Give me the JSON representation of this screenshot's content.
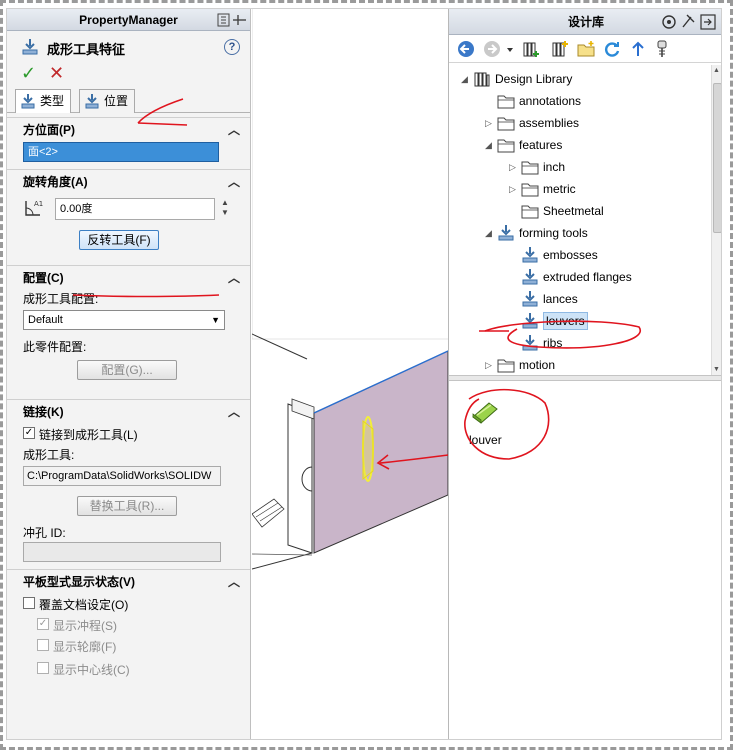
{
  "property_manager": {
    "title": "PropertyManager",
    "feature_name": "成形工具特征",
    "help": "?",
    "ok": "✓",
    "cancel": "✕",
    "tabs": [
      {
        "label": "类型",
        "active": true
      },
      {
        "label": "位置",
        "active": false
      }
    ],
    "orientation": {
      "header": "方位面(P)",
      "value": "面<2>"
    },
    "rotation": {
      "header": "旋转角度(A)",
      "value": "0.00度",
      "flip_button": "反转工具(F)"
    },
    "config": {
      "header": "配置(C)",
      "tool_config_label": "成形工具配置:",
      "tool_config_value": "Default",
      "part_config_label": "此零件配置:",
      "config_button": "配置(G)..."
    },
    "link": {
      "header": "链接(K)",
      "link_checkbox": "链接到成形工具(L)",
      "link_checked": true,
      "tool_label": "成形工具:",
      "tool_path": "C:\\ProgramData\\SolidWorks\\SOLIDW",
      "replace_button": "替换工具(R)...",
      "punch_id_label": "冲孔 ID:"
    },
    "flat": {
      "header": "平板型式显示状态(V)",
      "override": "覆盖文档设定(O)",
      "show_punch": "显示冲程(S)",
      "show_outline": "显示轮廓(F)",
      "show_centerline": "显示中心线(C)"
    }
  },
  "design_library": {
    "title": "设计库",
    "tree": [
      {
        "label": "Design Library",
        "level": 0,
        "expander": "expanded",
        "icon": "library-icon"
      },
      {
        "label": "annotations",
        "level": 1,
        "expander": "none",
        "icon": "folder-icon"
      },
      {
        "label": "assemblies",
        "level": 1,
        "expander": "collapsed",
        "icon": "folder-icon"
      },
      {
        "label": "features",
        "level": 1,
        "expander": "expanded",
        "icon": "folder-icon"
      },
      {
        "label": "inch",
        "level": 2,
        "expander": "collapsed",
        "icon": "folder-icon"
      },
      {
        "label": "metric",
        "level": 2,
        "expander": "collapsed",
        "icon": "folder-icon"
      },
      {
        "label": "Sheetmetal",
        "level": 2,
        "expander": "none",
        "icon": "folder-icon"
      },
      {
        "label": "forming tools",
        "level": 1,
        "expander": "expanded",
        "icon": "forming-tool-icon"
      },
      {
        "label": "embosses",
        "level": 2,
        "expander": "none",
        "icon": "forming-tool-icon"
      },
      {
        "label": "extruded flanges",
        "level": 2,
        "expander": "none",
        "icon": "forming-tool-icon"
      },
      {
        "label": "lances",
        "level": 2,
        "expander": "none",
        "icon": "forming-tool-icon"
      },
      {
        "label": "louvers",
        "level": 2,
        "expander": "none",
        "icon": "forming-tool-icon",
        "selected": true
      },
      {
        "label": "ribs",
        "level": 2,
        "expander": "none",
        "icon": "forming-tool-icon"
      },
      {
        "label": "motion",
        "level": 1,
        "expander": "collapsed",
        "icon": "folder-icon"
      }
    ],
    "preview_item": "louver"
  },
  "colors": {
    "annotation": "#e0141e",
    "selection": "#3c8fd8",
    "panel_face": "#c8b4c8",
    "highlight": "#f2ef3a"
  }
}
